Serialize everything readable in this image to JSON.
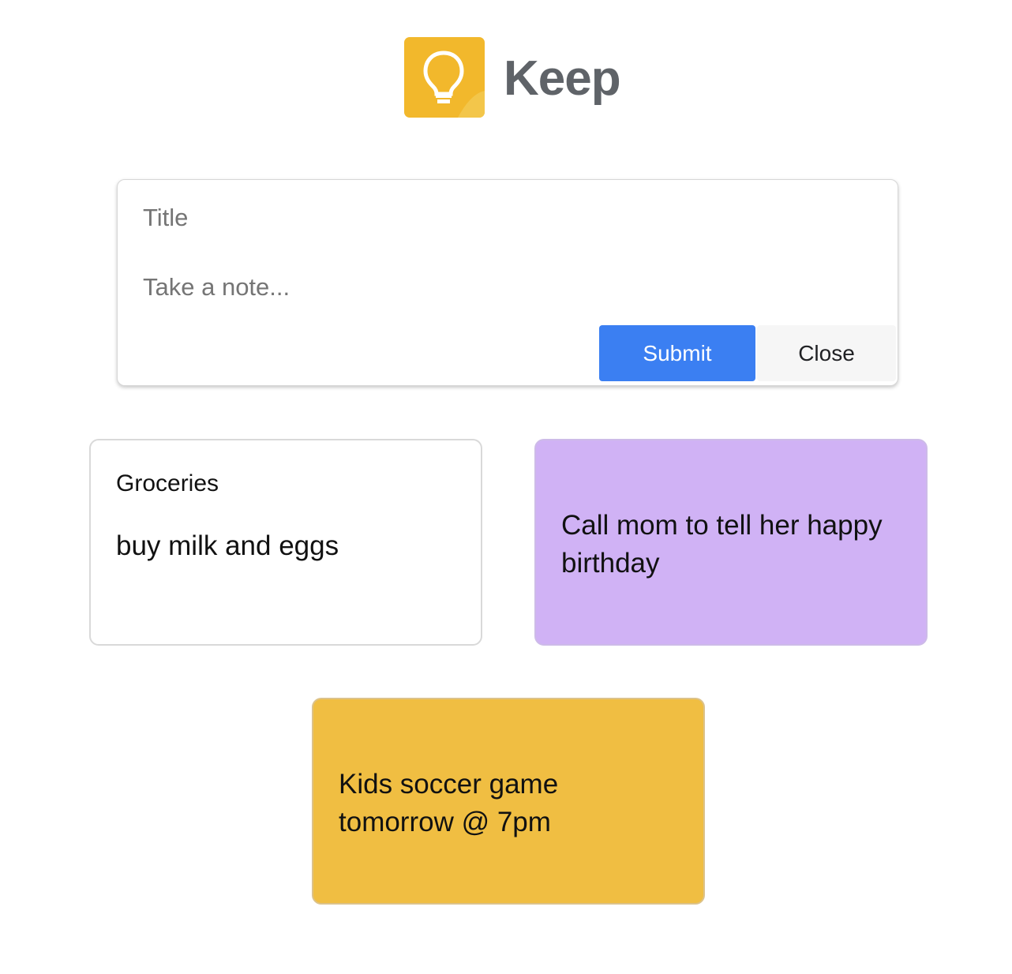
{
  "app": {
    "name": "Keep",
    "logo_icon": "lightbulb-icon",
    "logo_color": "#f2b82c"
  },
  "composer": {
    "title_placeholder": "Title",
    "note_placeholder": "Take a note...",
    "submit_label": "Submit",
    "close_label": "Close",
    "submit_color": "#3b7ff2"
  },
  "notes": [
    {
      "title": "Groceries",
      "body": "buy milk and eggs",
      "color": "#ffffff"
    },
    {
      "title": "",
      "body": "Call mom to tell her happy birthday",
      "color": "#d0b2f5"
    },
    {
      "title": "",
      "body": "Kids soccer game tomorrow @ 7pm",
      "color": "#f0be42"
    }
  ]
}
